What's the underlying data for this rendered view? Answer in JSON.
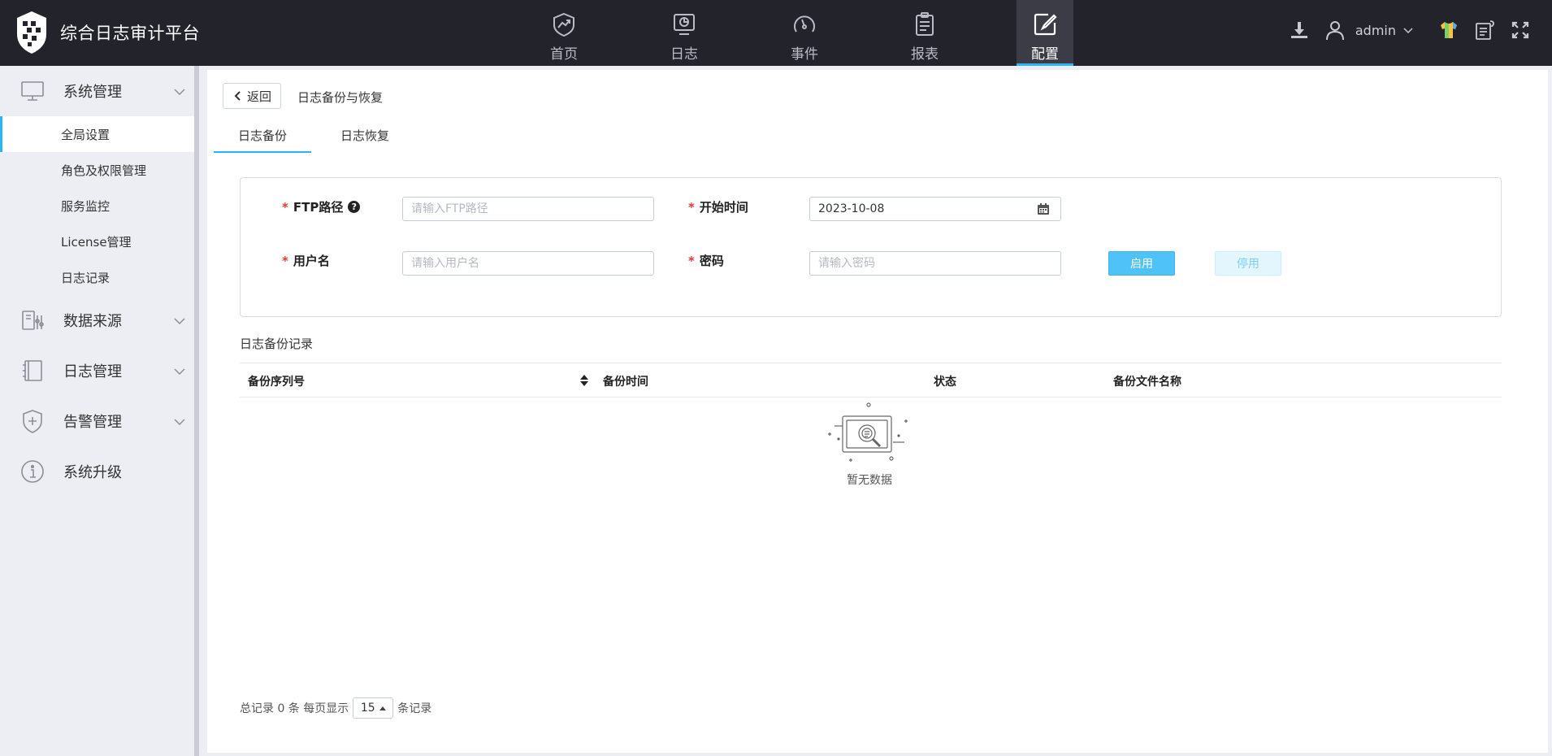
{
  "app": {
    "title": "综合日志审计平台"
  },
  "nav": [
    {
      "label": "首页",
      "icon": "trend-icon"
    },
    {
      "label": "日志",
      "icon": "monitor-icon"
    },
    {
      "label": "事件",
      "icon": "gauge-icon"
    },
    {
      "label": "报表",
      "icon": "clipboard-icon"
    },
    {
      "label": "配置",
      "icon": "edit-icon",
      "active": true
    }
  ],
  "topright": {
    "user": "admin"
  },
  "sidebar": {
    "groups": [
      {
        "label": "系统管理",
        "icon": "computer-icon"
      },
      {
        "label": "数据来源",
        "icon": "data-source-icon"
      },
      {
        "label": "日志管理",
        "icon": "notebook-icon"
      },
      {
        "label": "告警管理",
        "icon": "shield-plus-icon"
      },
      {
        "label": "系统升级",
        "icon": "info-icon"
      }
    ],
    "sub_items": [
      {
        "label": "全局设置",
        "active": true
      },
      {
        "label": "角色及权限管理"
      },
      {
        "label": "服务监控"
      },
      {
        "label": "License管理"
      },
      {
        "label": "日志记录"
      }
    ]
  },
  "page": {
    "back_label": "返回",
    "title": "日志备份与恢复",
    "tabs": [
      {
        "label": "日志备份",
        "active": true
      },
      {
        "label": "日志恢复"
      }
    ]
  },
  "form": {
    "ftp_label": "FTP路径",
    "ftp_placeholder": "请输入FTP路径",
    "start_label": "开始时间",
    "start_value": "2023-10-08",
    "user_label": "用户名",
    "user_placeholder": "请输入用户名",
    "password_label": "密码",
    "password_placeholder": "请输入密码",
    "enable_label": "启用",
    "disable_label": "停用",
    "required_mark": "*",
    "help_mark": "?"
  },
  "records": {
    "title": "日志备份记录",
    "columns": [
      "备份序列号",
      "备份时间",
      "状态",
      "备份文件名称"
    ],
    "empty_text": "暂无数据"
  },
  "pager": {
    "total_prefix": "总记录 0 条  每页显示",
    "page_size": "15",
    "suffix": "条记录"
  },
  "colors": {
    "accent": "#29b6f6",
    "topbar": "#23232b",
    "required": "#e53935"
  }
}
